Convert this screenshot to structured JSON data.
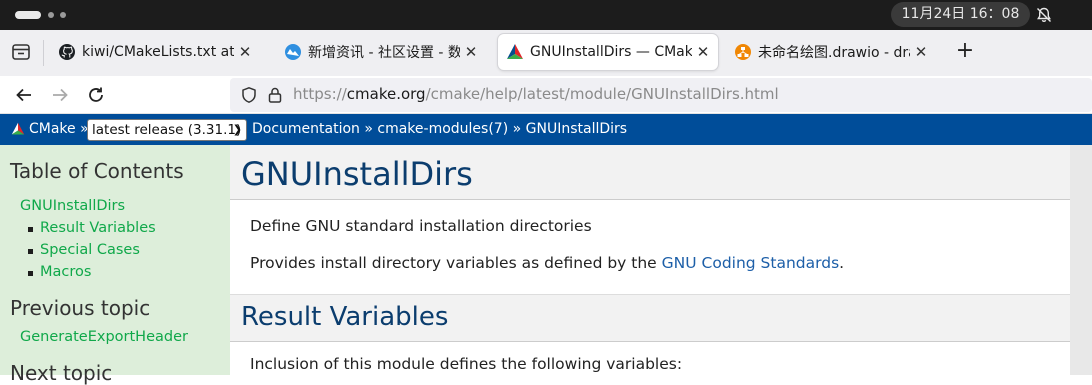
{
  "system": {
    "clock": "11月24日  16：08"
  },
  "tabs": [
    {
      "title": "kiwi/CMakeLists.txt at ur",
      "icon": "github-icon"
    },
    {
      "title": "新增资讯 - 社区设置 - 数据",
      "icon": "community-site-icon"
    },
    {
      "title": "GNUInstallDirs — CMake",
      "icon": "cmake-icon",
      "active": true
    },
    {
      "title": "未命名绘图.drawio - draw",
      "icon": "drawio-icon"
    }
  ],
  "url": {
    "prefix": "https://",
    "host": "cmake.org",
    "path": "/cmake/help/latest/module/GNUInstallDirs.html"
  },
  "cmake_bar": {
    "home": "CMake »",
    "version_select": "latest release (3.31.1)",
    "breadcrumbs": "Documentation » cmake-modules(7) » GNUInstallDirs"
  },
  "sidebar": {
    "toc_heading": "Table of Contents",
    "toc_root": "GNUInstallDirs",
    "toc_items": [
      "Result Variables",
      "Special Cases",
      "Macros"
    ],
    "prev_heading": "Previous topic",
    "prev_link": "GenerateExportHeader",
    "next_heading": "Next topic"
  },
  "main": {
    "title": "GNUInstallDirs",
    "intro": "Define GNU standard installation directories",
    "provides_before": "Provides install directory variables as defined by the ",
    "provides_link": "GNU Coding Standards",
    "provides_after": ".",
    "section_title": "Result Variables",
    "section_intro": "Inclusion of this module defines the following variables:"
  },
  "colors": {
    "cmake_blue": "#004d99",
    "sidebar_bg": "#ddeeda",
    "link_green": "#10a84a",
    "heading_blue": "#0b3d6e"
  }
}
